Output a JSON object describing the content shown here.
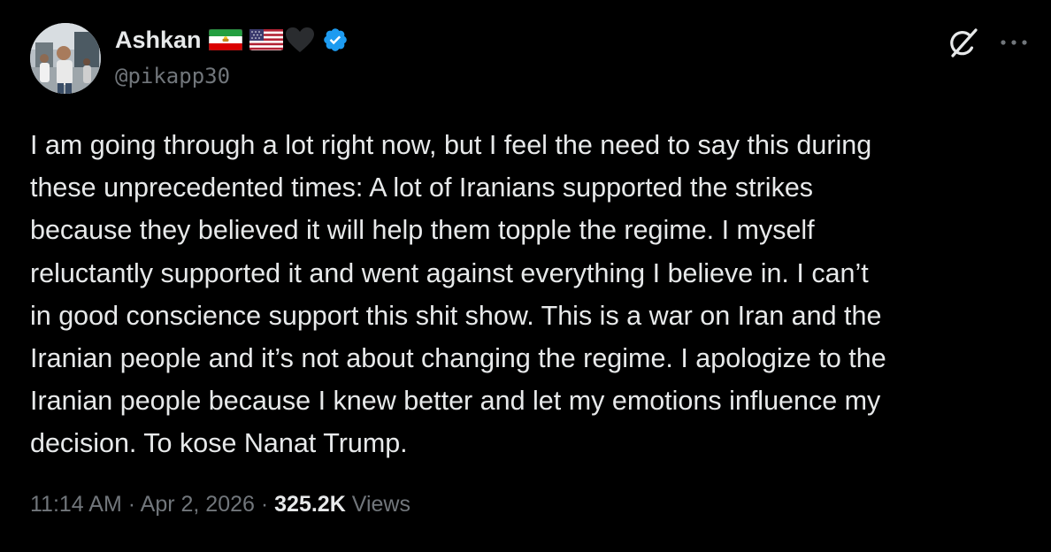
{
  "author": {
    "display_name": "Ashkan",
    "handle": "@pikapp30",
    "badges": [
      "iran-lion-and-sun-flag-icon",
      "us-flag-icon",
      "black-heart-icon",
      "verified-badge-icon"
    ],
    "verified_color": "#1d9bf0"
  },
  "actions": {
    "grok_icon": "grok-icon",
    "more_icon": "more-options-icon"
  },
  "tweet": {
    "lines": [
      "I am going through a lot right now, but I feel the need to say this during",
      "these unprecedented times: A lot of Iranians supported the strikes",
      "because they believed it will help them topple the regime. I myself",
      "reluctantly supported it and went against everything I believe in. I can’t",
      "in good conscience support this shit show. This is a war on Iran and the",
      "Iranian people and it’s not about changing the regime. I apologize to the",
      "Iranian people because I knew better and let my emotions influence my",
      "decision. To kose Nanat Trump."
    ]
  },
  "meta": {
    "time": "11:14 AM",
    "separator": "·",
    "date": "Apr 2, 2026",
    "views_count": "325.2K",
    "views_label": "Views"
  },
  "colors": {
    "background": "#000000",
    "text_primary": "#e7e9ea",
    "text_secondary": "#71767b"
  }
}
